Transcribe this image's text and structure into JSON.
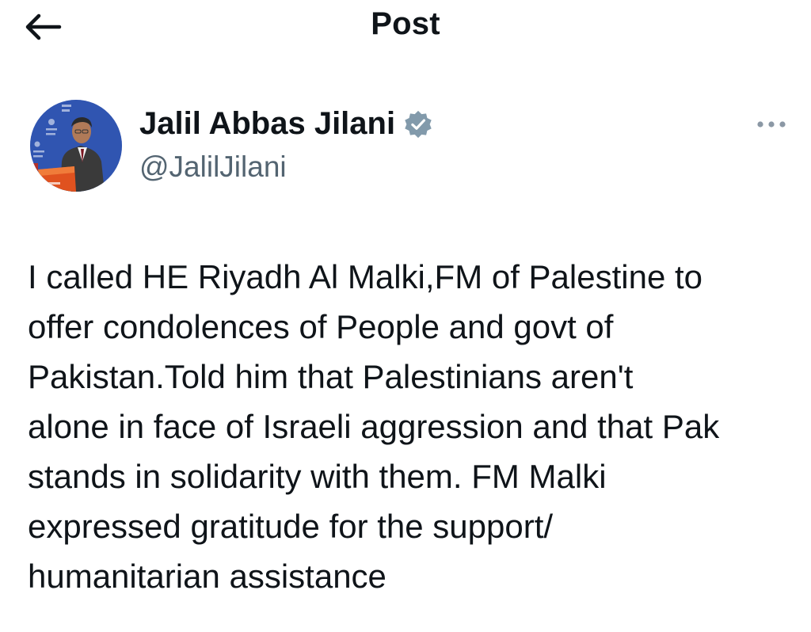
{
  "header": {
    "back_icon": "arrow-left-icon",
    "title": "Post"
  },
  "author": {
    "display_name": "Jalil Abbas Jilani",
    "handle": "@JalilJilani",
    "verified_icon": "verified-badge-icon",
    "verified_color": "#829aab",
    "more_icon": "more-horizontal-icon"
  },
  "tweet": {
    "text": "I called HE Riyadh Al Malki,FM of Palestine to\noffer condolences of People and govt of\nPakistan.Told him that Palestinians aren't\nalone in face of Israeli aggression and that Pak\nstands in solidarity with them. FM Malki\nexpressed gratitude for the support/\nhumanitarian assistance"
  },
  "colors": {
    "text_primary": "#0f1419",
    "text_secondary": "#536471",
    "avatar_bg": "#2c4fa8"
  }
}
